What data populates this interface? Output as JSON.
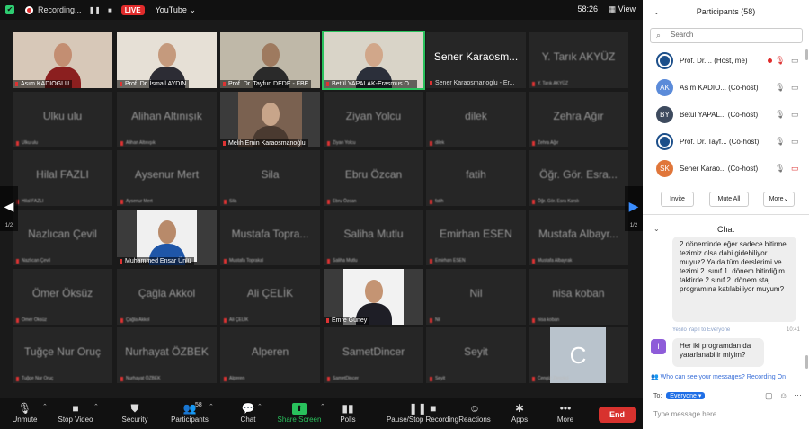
{
  "topbar": {
    "recording_label": "Recording...",
    "pause_icon": "pause-icon",
    "stop_icon": "stop-icon",
    "live_badge": "LIVE",
    "stream_target": "YouTube",
    "timer": "58:26",
    "view_label": "View"
  },
  "gallery": {
    "left_page": "1/2",
    "right_page": "1/2",
    "tiles": [
      {
        "name": "",
        "label": "Asım KADIOGLU",
        "video": true
      },
      {
        "name": "",
        "label": "Prof. Dr. İsmail AYDIN",
        "video": true
      },
      {
        "name": "",
        "label": "Prof. Dr. Tayfun DEDE - FBE",
        "video": true
      },
      {
        "name": "",
        "label": "Betül YAPALAK-Erasmus O...",
        "video": true,
        "active": true
      },
      {
        "name": "Sener Karaosm...",
        "label": "Sener Karaosmanoglu - Er...",
        "video": false,
        "clear": true
      },
      {
        "name": "Y. Tarık AKYÜZ",
        "label": "Y. Tarık AKYÜZ",
        "video": false
      },
      {
        "name": "Ulku ulu",
        "label": "Ulku ulu",
        "video": false
      },
      {
        "name": "Alihan Altınışık",
        "label": "Alihan Altınışık",
        "video": false
      },
      {
        "name": "",
        "label": "Melih Emin Karaosmanoğlu",
        "video": true
      },
      {
        "name": "Ziyan Yolcu",
        "label": "Ziyan Yolcu",
        "video": false
      },
      {
        "name": "dilek",
        "label": "dilek",
        "video": false
      },
      {
        "name": "Zehra Ağır",
        "label": "Zehra Ağır",
        "video": false
      },
      {
        "name": "Hilal FAZLI",
        "label": "Hilal FAZLI",
        "video": false
      },
      {
        "name": "Aysenur Mert",
        "label": "Aysenur Mert",
        "video": false
      },
      {
        "name": "Sila",
        "label": "Sila",
        "video": false
      },
      {
        "name": "Ebru Özcan",
        "label": "Ebru Özcan",
        "video": false
      },
      {
        "name": "fatih",
        "label": "fatih",
        "video": false
      },
      {
        "name": "Öğr. Gör. Esra...",
        "label": "Öğr. Gör. Esra Karslı",
        "video": false
      },
      {
        "name": "Nazlıcan Çevil",
        "label": "Nazlıcan Çevil",
        "video": false
      },
      {
        "name": "",
        "label": "Muhammed Ensar Ünlü",
        "video": true
      },
      {
        "name": "Mustafa Topra...",
        "label": "Mustafa Toprakal",
        "video": false
      },
      {
        "name": "Saliha Mutlu",
        "label": "Saliha Mutlu",
        "video": false
      },
      {
        "name": "Emirhan ESEN",
        "label": "Emirhan ESEN",
        "video": false
      },
      {
        "name": "Mustafa Albayr...",
        "label": "Mustafa Albayrak",
        "video": false
      },
      {
        "name": "Ömer Öksüz",
        "label": "Ömer Öksüz",
        "video": false
      },
      {
        "name": "Çağla Akkol",
        "label": "Çağla Akkol",
        "video": false
      },
      {
        "name": "Ali ÇELİK",
        "label": "Ali ÇELİK",
        "video": false
      },
      {
        "name": "",
        "label": "Emre Güney",
        "video": true
      },
      {
        "name": "Nil",
        "label": "Nil",
        "video": false
      },
      {
        "name": "nisa koban",
        "label": "nisa koban",
        "video": false
      },
      {
        "name": "Tuğçe Nur Oruç",
        "label": "Tuğçe Nur Oruç",
        "video": false
      },
      {
        "name": "Nurhayat ÖZBEK",
        "label": "Nurhayat ÖZBEK",
        "video": false
      },
      {
        "name": "Alperen",
        "label": "Alperen",
        "video": false
      },
      {
        "name": "SametDincer",
        "label": "SametDincer",
        "video": false
      },
      {
        "name": "Seyit",
        "label": "Seyit",
        "video": false
      },
      {
        "name": "",
        "label": "Cengiz Zencirci",
        "video": false,
        "avatar_letter": "C"
      }
    ]
  },
  "toolbar": {
    "items": [
      {
        "label": "Unmute",
        "icon": "mic-muted-icon"
      },
      {
        "label": "Stop Video",
        "icon": "video-camera-icon"
      },
      {
        "label": "Security",
        "icon": "shield-icon"
      },
      {
        "label": "Participants",
        "icon": "participants-icon",
        "badge": "58"
      },
      {
        "label": "Chat",
        "icon": "chat-bubble-icon"
      },
      {
        "label": "Share Screen",
        "icon": "share-screen-icon"
      },
      {
        "label": "Polls",
        "icon": "polls-icon"
      },
      {
        "label": "Pause/Stop Recording",
        "icon": "pause-stop-recording-icon"
      },
      {
        "label": "Reactions",
        "icon": "reactions-icon"
      },
      {
        "label": "Apps",
        "icon": "apps-icon"
      },
      {
        "label": "More",
        "icon": "more-dots-icon"
      }
    ],
    "end_label": "End"
  },
  "participants_panel": {
    "title": "Participants (58)",
    "search_placeholder": "Search",
    "rows": [
      {
        "name": "Prof. Dr....",
        "role": "(Host, me)",
        "avatar": "",
        "avatar_color": "#1c4f8a",
        "rec_dot": true
      },
      {
        "name": "Asım KADIO...",
        "role": "(Co-host)",
        "avatar": "AK",
        "avatar_color": "#5b8bd9"
      },
      {
        "name": "Betül YAPAL...",
        "role": "(Co-host)",
        "avatar": "BY",
        "avatar_color": "#3d4a5e"
      },
      {
        "name": "Prof. Dr. Tayf...",
        "role": "(Co-host)",
        "avatar": "",
        "avatar_color": "#1c4f8a"
      },
      {
        "name": "Sener Karao...",
        "role": "(Co-host)",
        "avatar": "SK",
        "avatar_color": "#e0763a"
      }
    ],
    "invite_label": "Invite",
    "mute_all_label": "Mute All",
    "more_label": "More"
  },
  "chat_panel": {
    "title": "Chat",
    "message_1": "2.döneminde eğer sadece bitirme tezimiz olsa dahi gidebiliyor muyuz? Ya da tüm derslerimi ve tezimi 2. sınıf 1. dönem bitirdiğim taktirde 2.sınıf 2. dönem staj programına katılabiliyor muyum?",
    "sender_2": "Yeşilo Yapıl to Everyone",
    "time_2": "10:41",
    "avatar_2": "i",
    "message_2": "Her iki programdan da yararlanabilir miyim?",
    "visibility_note": "Who can see your messages? Recording On",
    "to_label": "To:",
    "to_value": "Everyone",
    "input_placeholder": "Type message here..."
  },
  "colors": {
    "accent_green": "#29c15c",
    "end_red": "#d8322e",
    "link_blue": "#1f6fe6"
  }
}
